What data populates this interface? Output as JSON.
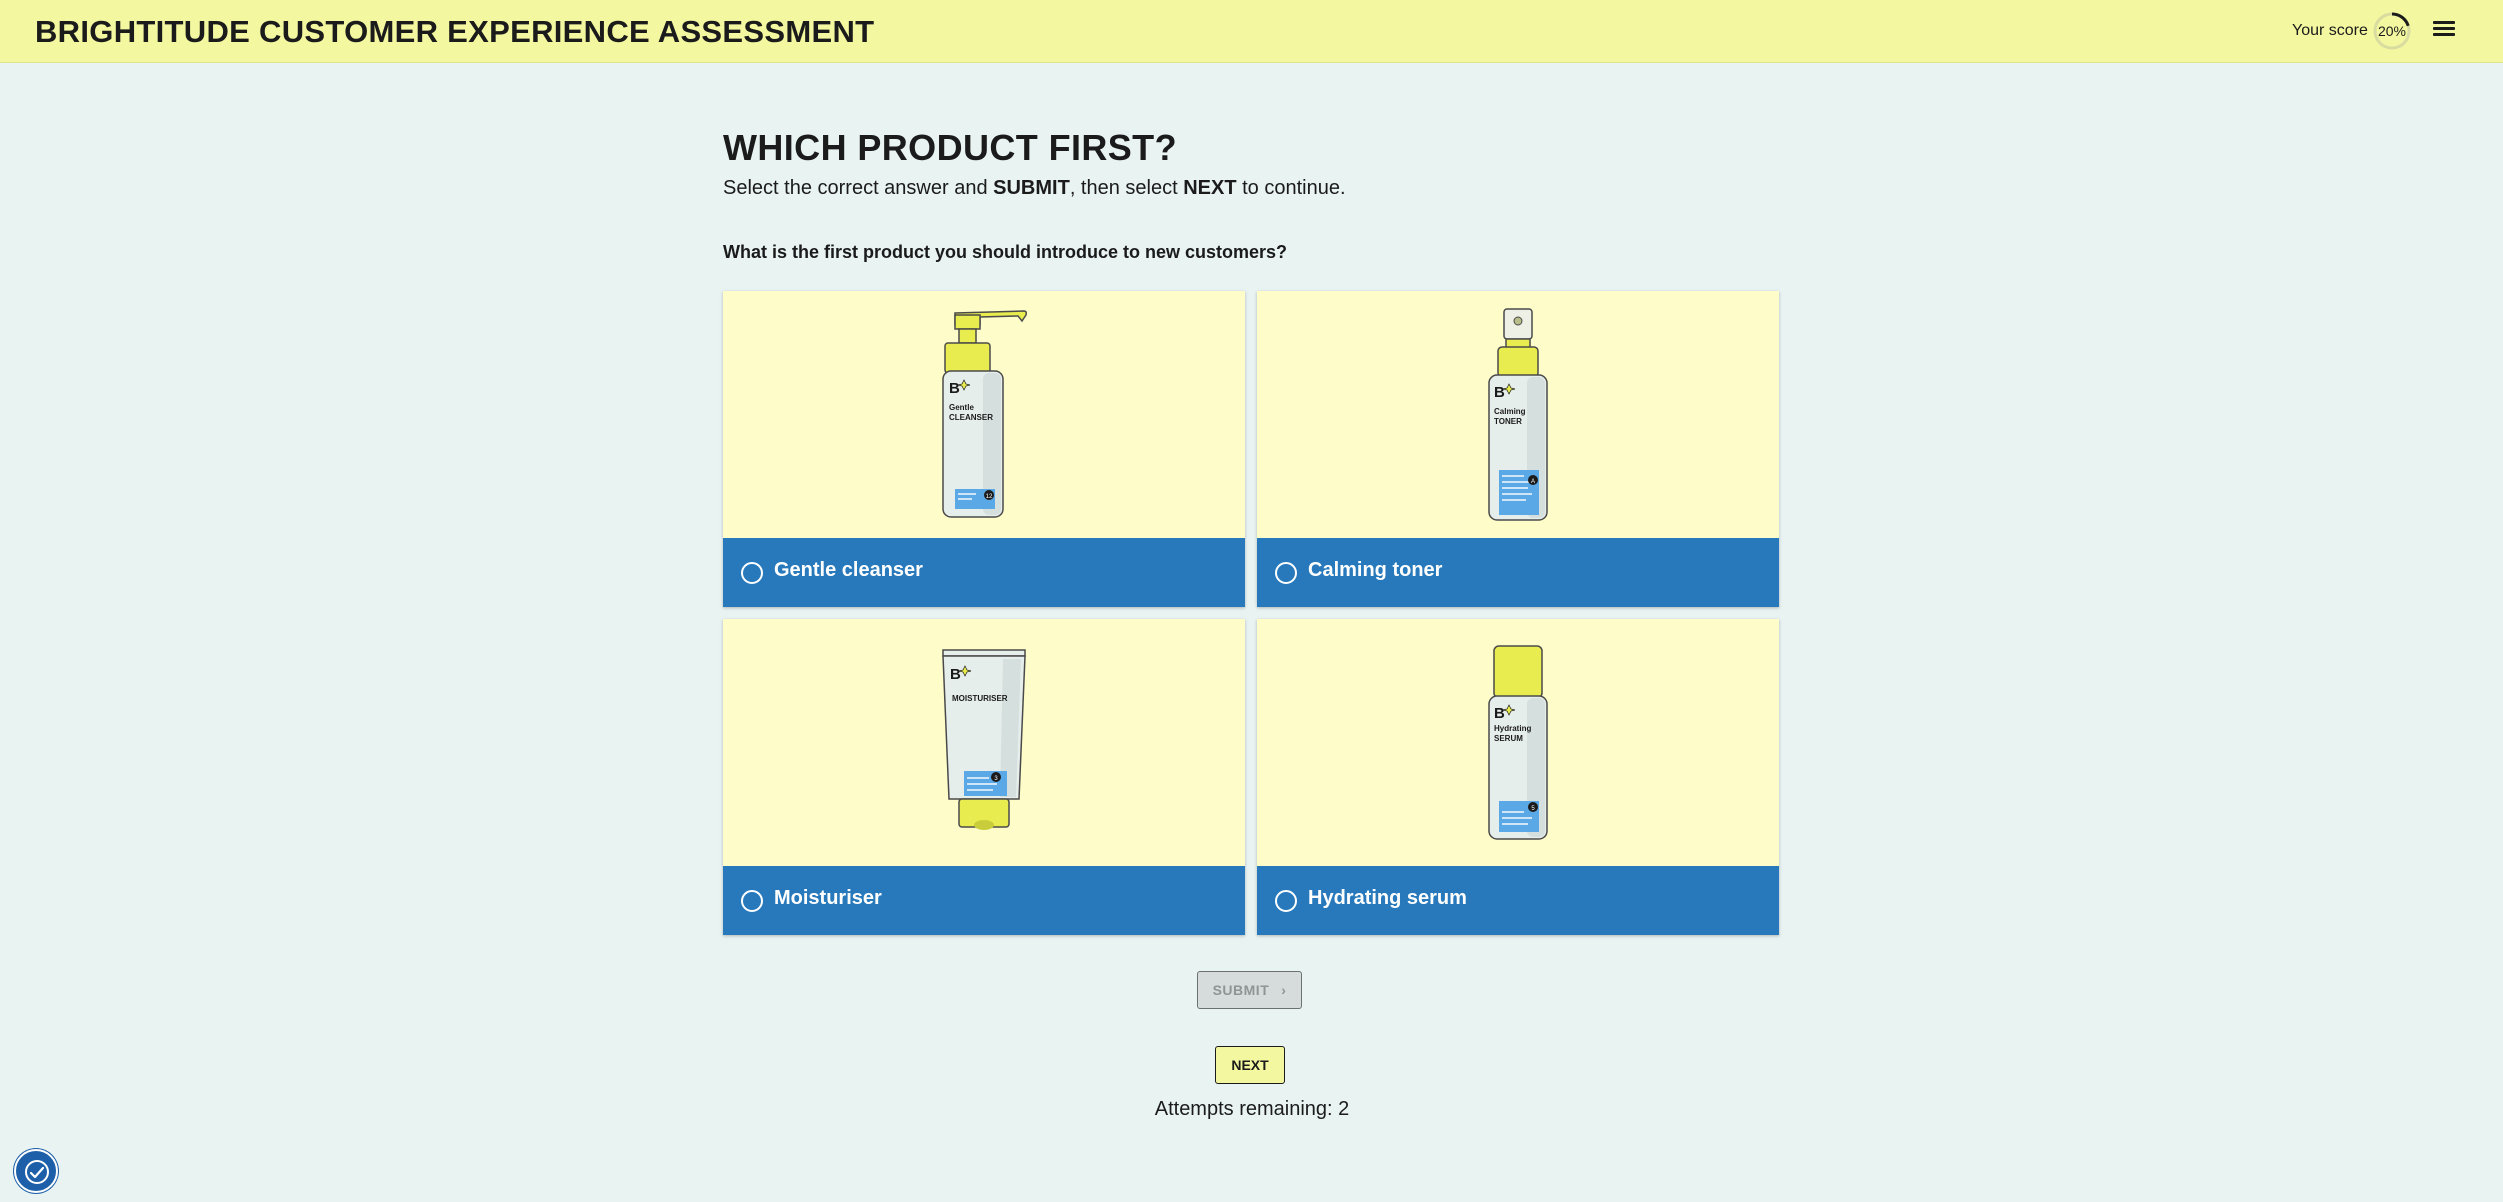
{
  "header": {
    "title": "BRIGHTITUDE CUSTOMER EXPERIENCE ASSESSMENT",
    "score_label": "Your score",
    "score_value": "20%",
    "score_fraction": 0.2,
    "menu_icon": "hamburger-menu-icon"
  },
  "question": {
    "title": "WHICH PRODUCT FIRST?",
    "instructions": {
      "part1": "Select the correct answer and ",
      "submit_word": "SUBMIT",
      "part2": ", then select ",
      "next_word": "NEXT",
      "part3": " to continue."
    },
    "prompt": "What is the first product you should introduce to new customers?"
  },
  "options": [
    {
      "label": "Gentle cleanser",
      "product_brand": "B",
      "product_text_line1": "Gentle",
      "product_text_line2": "CLEANSER",
      "product_number": "12",
      "selected": false
    },
    {
      "label": "Calming toner",
      "product_brand": "B",
      "product_text_line1": "Calming",
      "product_text_line2": "TONER",
      "product_number": "A",
      "selected": false
    },
    {
      "label": "Moisturiser",
      "product_brand": "B",
      "product_text_line1": "MOISTURISER",
      "product_number": "3",
      "selected": false
    },
    {
      "label": "Hydrating serum",
      "product_brand": "B",
      "product_text_line1": "Hydrating",
      "product_text_line2": "SERUM",
      "product_number": "5",
      "selected": false
    }
  ],
  "buttons": {
    "submit_label": "SUBMIT",
    "submit_disabled": true,
    "next_label": "NEXT"
  },
  "attempts_text": "Attempts remaining: 2",
  "accessibility_icon": "accessibility-icon",
  "colors": {
    "header_bg": "#f3f79f",
    "page_bg": "#e8f3f2",
    "card_bg": "#fefdc9",
    "option_bar": "#2779bc",
    "product_yellow": "#e8ec4f"
  }
}
